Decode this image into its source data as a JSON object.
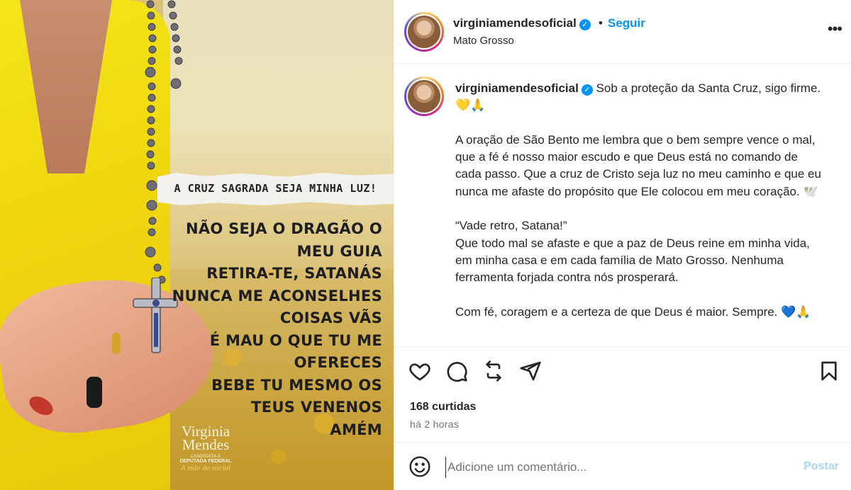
{
  "media": {
    "banner_text": "A CRUZ SAGRADA SEJA MINHA LUZ!",
    "prayer_lines": [
      "NÃO SEJA O DRAGÃO O",
      "MEU GUIA",
      "RETIRA-TE, SATANÁS",
      "NUNCA ME ACONSELHES",
      "COISAS VÃS",
      "É MAU O QUE TU ME",
      "OFERECES",
      "BEBE TU MESMO OS",
      "TEUS VENENOS",
      "AMÉM"
    ],
    "logo": {
      "name_line1": "Virginia",
      "name_line2": "Mendes",
      "role_line1": "CANDIDATA À",
      "role_line2": "DEPUTADA FEDERAL",
      "tagline": "A mãe do social"
    }
  },
  "header": {
    "username": "virginiamendesoficial",
    "verified_mark": "✓",
    "separator": "•",
    "follow_label": "Seguir",
    "location": "Mato Grosso",
    "more_label": "•••"
  },
  "caption": {
    "username": "virginiamendesoficial",
    "intro": "Sob a proteção da Santa Cruz, sigo firme. 💛🙏",
    "paragraph2": "A oração de São Bento me lembra que o bem sempre vence o mal, que a fé é nosso maior escudo e que Deus está no comando de cada passo. Que a cruz de Cristo seja luz no meu caminho e que eu nunca me afaste do propósito que Ele colocou em meu coração. 🕊️",
    "quote": "“Vade retro, Satana!”",
    "paragraph3": "Que todo mal se afaste e que a paz de Deus reine em minha vida, em minha casa e em cada família de Mato Grosso. Nenhuma ferramenta forjada contra nós prosperará.",
    "closing": "Com fé, coragem e a certeza de que Deus é maior. Sempre. 💙🙏"
  },
  "actions": {
    "icons": [
      "heart-icon",
      "comment-icon",
      "repost-icon",
      "share-icon",
      "bookmark-icon"
    ],
    "likes": "168 curtidas",
    "time": "há 2 horas"
  },
  "comment": {
    "placeholder": "Adicione um comentário...",
    "post_label": "Postar"
  },
  "colors": {
    "accent": "#0095f6",
    "post_disabled": "#a8d4f8",
    "text": "#262626",
    "muted": "#737373"
  }
}
